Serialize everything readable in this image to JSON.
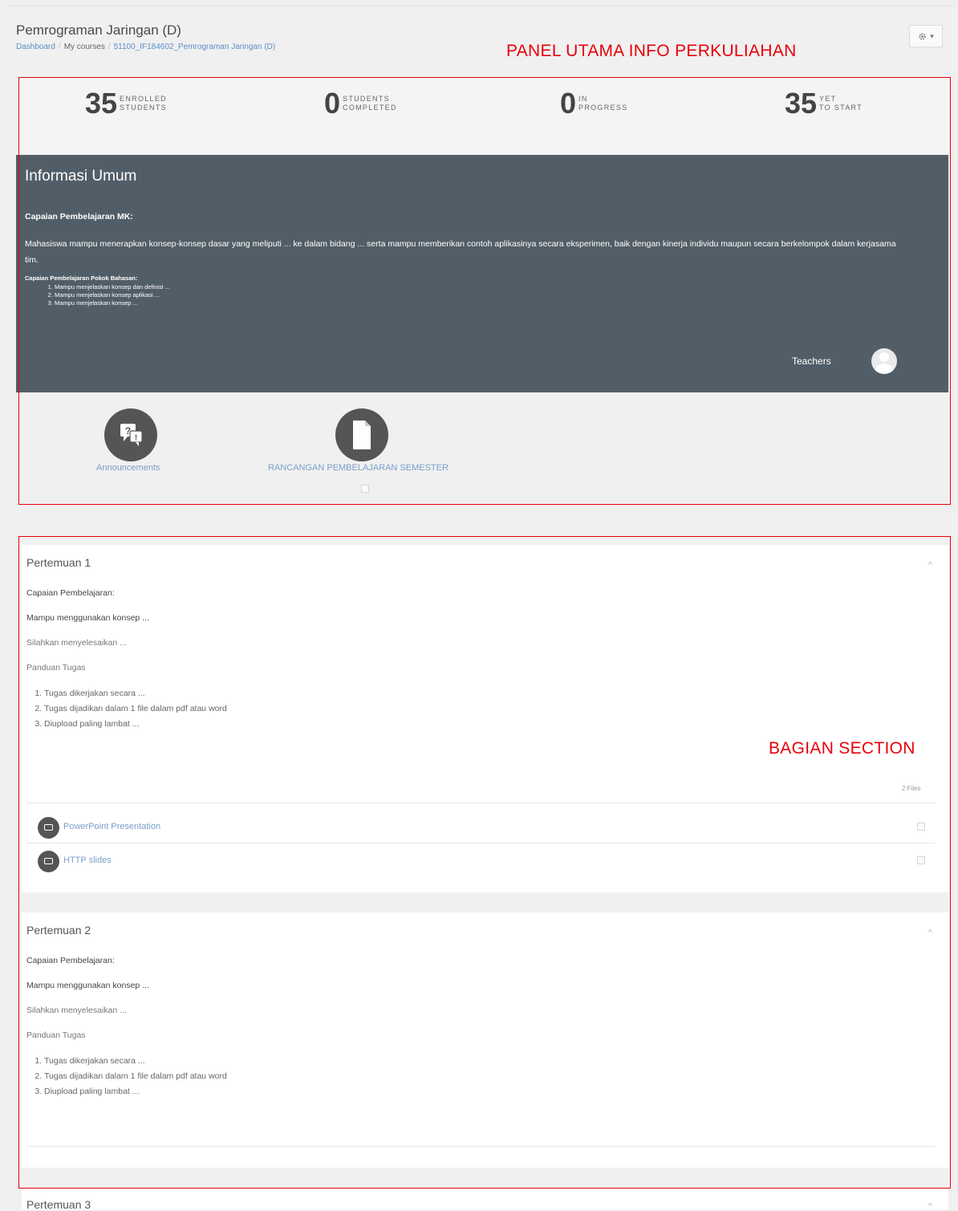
{
  "header": {
    "course_title": "Pemrograman Jaringan (D)",
    "breadcrumb": [
      "Dashboard",
      "My courses",
      "51100_IF184602_Pemrograman Jaringan (D)"
    ],
    "settings_icon": "gear-icon",
    "settings_caret": "▾"
  },
  "annotations": {
    "main_panel": "PANEL UTAMA INFO PERKULIAHAN",
    "section": "BAGIAN SECTION",
    "color": "#e8000a"
  },
  "stats": [
    {
      "value": "35",
      "label_line1": "ENROLLED",
      "label_line2": "STUDENTS"
    },
    {
      "value": "0",
      "label_line1": "STUDENTS",
      "label_line2": "COMPLETED"
    },
    {
      "value": "0",
      "label_line1": "IN",
      "label_line2": "PROGRESS"
    },
    {
      "value": "35",
      "label_line1": "YET",
      "label_line2": "TO START"
    }
  ],
  "info": {
    "title": "Informasi Umum",
    "cap_heading": "Capaian Pembelajaran MK:",
    "desc": "Mahasiswa mampu menerapkan konsep-konsep dasar yang meliputi ... ke dalam bidang ... serta  mampu  memberikan contoh aplikasinya secara eksperimen, baik dengan kinerja individu maupun secara berkelompok dalam kerjasama tim.",
    "sub_heading": "Capaian Pembelajaran Pokok Bahasan:",
    "items": [
      "Mampu menjelaskan konsep dan definisi ...",
      "Mampu menjelaskan konsep aplikasi ...",
      "Mampu menjelaskan konsep ..."
    ],
    "teachers_label": "Teachers",
    "background_color": "#525e67"
  },
  "tiles": [
    {
      "label": "Announcements",
      "icon": "forum-icon"
    },
    {
      "label": "RANCANGAN PEMBELAJARAN SEMESTER",
      "icon": "file-icon"
    }
  ],
  "sections": [
    {
      "title": "Pertemuan 1",
      "cap": "Capaian Pembelajaran:",
      "konsep": "Mampu menggunakan konsep ...",
      "silahkan": "Silahkan menyelesaikan ...",
      "panduan": "Panduan Tugas",
      "tasks": [
        "Tugas dikerjakan secara ...",
        "Tugas dijadikan dalam 1 file dalam pdf atau word",
        "Diupload paling lambat ..."
      ],
      "files_count": "2 Files",
      "files": [
        "PowerPoint Presentation",
        "HTTP slides"
      ]
    },
    {
      "title": "Pertemuan 2",
      "cap": "Capaian Pembelajaran:",
      "konsep": "Mampu menggunakan konsep ...",
      "silahkan": "Silahkan menyelesaikan ...",
      "panduan": "Panduan Tugas",
      "tasks": [
        "Tugas dikerjakan secara ...",
        "Tugas dijadikan dalam 1 file dalam pdf atau word",
        "Diupload paling lambat ..."
      ]
    },
    {
      "title": "Pertemuan 3"
    }
  ],
  "chevron_icon": "chevron-up-icon",
  "chevron_char": "^"
}
